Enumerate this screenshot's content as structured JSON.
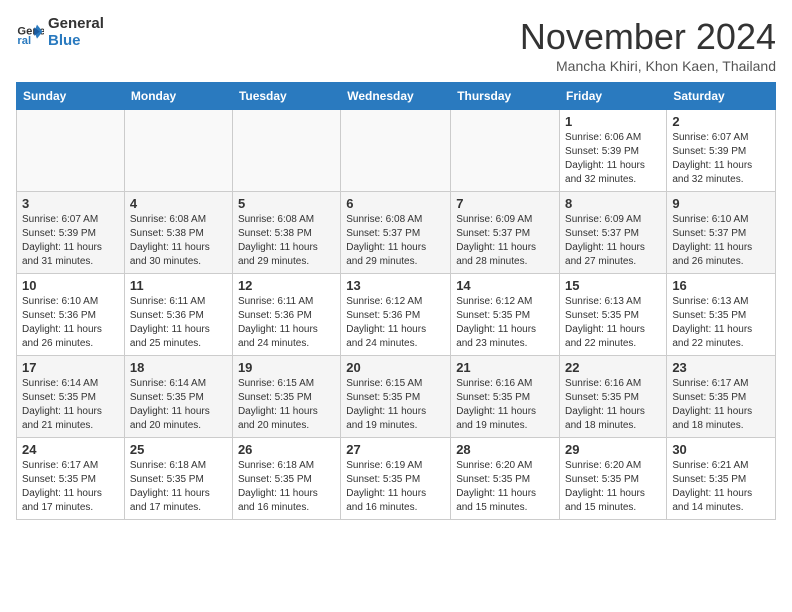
{
  "logo": {
    "line1": "General",
    "line2": "Blue"
  },
  "title": "November 2024",
  "subtitle": "Mancha Khiri, Khon Kaen, Thailand",
  "days_of_week": [
    "Sunday",
    "Monday",
    "Tuesday",
    "Wednesday",
    "Thursday",
    "Friday",
    "Saturday"
  ],
  "weeks": [
    [
      {
        "day": "",
        "info": ""
      },
      {
        "day": "",
        "info": ""
      },
      {
        "day": "",
        "info": ""
      },
      {
        "day": "",
        "info": ""
      },
      {
        "day": "",
        "info": ""
      },
      {
        "day": "1",
        "info": "Sunrise: 6:06 AM\nSunset: 5:39 PM\nDaylight: 11 hours and 32 minutes."
      },
      {
        "day": "2",
        "info": "Sunrise: 6:07 AM\nSunset: 5:39 PM\nDaylight: 11 hours and 32 minutes."
      }
    ],
    [
      {
        "day": "3",
        "info": "Sunrise: 6:07 AM\nSunset: 5:39 PM\nDaylight: 11 hours and 31 minutes."
      },
      {
        "day": "4",
        "info": "Sunrise: 6:08 AM\nSunset: 5:38 PM\nDaylight: 11 hours and 30 minutes."
      },
      {
        "day": "5",
        "info": "Sunrise: 6:08 AM\nSunset: 5:38 PM\nDaylight: 11 hours and 29 minutes."
      },
      {
        "day": "6",
        "info": "Sunrise: 6:08 AM\nSunset: 5:37 PM\nDaylight: 11 hours and 29 minutes."
      },
      {
        "day": "7",
        "info": "Sunrise: 6:09 AM\nSunset: 5:37 PM\nDaylight: 11 hours and 28 minutes."
      },
      {
        "day": "8",
        "info": "Sunrise: 6:09 AM\nSunset: 5:37 PM\nDaylight: 11 hours and 27 minutes."
      },
      {
        "day": "9",
        "info": "Sunrise: 6:10 AM\nSunset: 5:37 PM\nDaylight: 11 hours and 26 minutes."
      }
    ],
    [
      {
        "day": "10",
        "info": "Sunrise: 6:10 AM\nSunset: 5:36 PM\nDaylight: 11 hours and 26 minutes."
      },
      {
        "day": "11",
        "info": "Sunrise: 6:11 AM\nSunset: 5:36 PM\nDaylight: 11 hours and 25 minutes."
      },
      {
        "day": "12",
        "info": "Sunrise: 6:11 AM\nSunset: 5:36 PM\nDaylight: 11 hours and 24 minutes."
      },
      {
        "day": "13",
        "info": "Sunrise: 6:12 AM\nSunset: 5:36 PM\nDaylight: 11 hours and 24 minutes."
      },
      {
        "day": "14",
        "info": "Sunrise: 6:12 AM\nSunset: 5:35 PM\nDaylight: 11 hours and 23 minutes."
      },
      {
        "day": "15",
        "info": "Sunrise: 6:13 AM\nSunset: 5:35 PM\nDaylight: 11 hours and 22 minutes."
      },
      {
        "day": "16",
        "info": "Sunrise: 6:13 AM\nSunset: 5:35 PM\nDaylight: 11 hours and 22 minutes."
      }
    ],
    [
      {
        "day": "17",
        "info": "Sunrise: 6:14 AM\nSunset: 5:35 PM\nDaylight: 11 hours and 21 minutes."
      },
      {
        "day": "18",
        "info": "Sunrise: 6:14 AM\nSunset: 5:35 PM\nDaylight: 11 hours and 20 minutes."
      },
      {
        "day": "19",
        "info": "Sunrise: 6:15 AM\nSunset: 5:35 PM\nDaylight: 11 hours and 20 minutes."
      },
      {
        "day": "20",
        "info": "Sunrise: 6:15 AM\nSunset: 5:35 PM\nDaylight: 11 hours and 19 minutes."
      },
      {
        "day": "21",
        "info": "Sunrise: 6:16 AM\nSunset: 5:35 PM\nDaylight: 11 hours and 19 minutes."
      },
      {
        "day": "22",
        "info": "Sunrise: 6:16 AM\nSunset: 5:35 PM\nDaylight: 11 hours and 18 minutes."
      },
      {
        "day": "23",
        "info": "Sunrise: 6:17 AM\nSunset: 5:35 PM\nDaylight: 11 hours and 18 minutes."
      }
    ],
    [
      {
        "day": "24",
        "info": "Sunrise: 6:17 AM\nSunset: 5:35 PM\nDaylight: 11 hours and 17 minutes."
      },
      {
        "day": "25",
        "info": "Sunrise: 6:18 AM\nSunset: 5:35 PM\nDaylight: 11 hours and 17 minutes."
      },
      {
        "day": "26",
        "info": "Sunrise: 6:18 AM\nSunset: 5:35 PM\nDaylight: 11 hours and 16 minutes."
      },
      {
        "day": "27",
        "info": "Sunrise: 6:19 AM\nSunset: 5:35 PM\nDaylight: 11 hours and 16 minutes."
      },
      {
        "day": "28",
        "info": "Sunrise: 6:20 AM\nSunset: 5:35 PM\nDaylight: 11 hours and 15 minutes."
      },
      {
        "day": "29",
        "info": "Sunrise: 6:20 AM\nSunset: 5:35 PM\nDaylight: 11 hours and 15 minutes."
      },
      {
        "day": "30",
        "info": "Sunrise: 6:21 AM\nSunset: 5:35 PM\nDaylight: 11 hours and 14 minutes."
      }
    ]
  ]
}
